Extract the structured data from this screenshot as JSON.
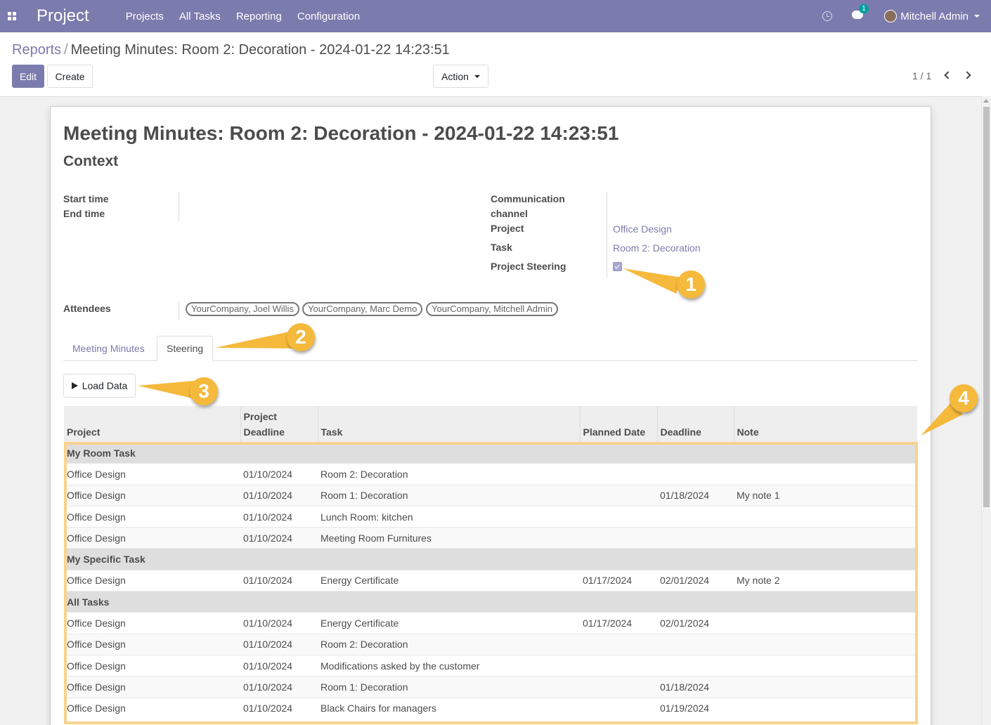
{
  "navbar": {
    "app_name": "Project",
    "menu": [
      "Projects",
      "All Tasks",
      "Reporting",
      "Configuration"
    ],
    "chat_badge": "1",
    "user": "Mitchell Admin",
    "bg_color": "#7c7bad"
  },
  "control_panel": {
    "breadcrumb_parent": "Reports",
    "breadcrumb_sep": "/",
    "breadcrumb_current": "Meeting Minutes: Room 2: Decoration - 2024-01-22 14:23:51",
    "edit_label": "Edit",
    "create_label": "Create",
    "action_label": "Action",
    "pager": "1 / 1"
  },
  "form": {
    "title": "Meeting Minutes: Room 2: Decoration - 2024-01-22 14:23:51",
    "subtitle": "Context",
    "start_time_label": "Start time",
    "end_time_label": "End time",
    "comm_channel_label_1": "Communication",
    "comm_channel_label_2": "channel",
    "project_label": "Project",
    "project_value": "Office Design",
    "task_label": "Task",
    "task_value": "Room 2: Decoration",
    "steering_label": "Project Steering",
    "steering_checked": true,
    "attendees_label": "Attendees",
    "attendees": [
      "YourCompany, Joel Willis",
      "YourCompany, Marc Demo",
      "YourCompany, Mitchell Admin"
    ]
  },
  "tabs": [
    "Meeting Minutes",
    "Steering"
  ],
  "load_button": "Load Data",
  "table": {
    "headers": {
      "project": "Project",
      "project_deadline_1": "Project",
      "project_deadline_2": "Deadline",
      "task": "Task",
      "planned_date": "Planned Date",
      "deadline": "Deadline",
      "note": "Note"
    },
    "rows": [
      {
        "group": "My Room Task"
      },
      {
        "project": "Office Design",
        "project_deadline": "01/10/2024",
        "task": "Room 2: Decoration",
        "planned": "",
        "deadline": "",
        "note": ""
      },
      {
        "project": "Office Design",
        "project_deadline": "01/10/2024",
        "task": "Room 1: Decoration",
        "planned": "",
        "deadline": "01/18/2024",
        "note": "My note 1"
      },
      {
        "project": "Office Design",
        "project_deadline": "01/10/2024",
        "task": "Lunch Room: kitchen",
        "planned": "",
        "deadline": "",
        "note": ""
      },
      {
        "project": "Office Design",
        "project_deadline": "01/10/2024",
        "task": "Meeting Room Furnitures",
        "planned": "",
        "deadline": "",
        "note": ""
      },
      {
        "group": "My Specific Task"
      },
      {
        "project": "Office Design",
        "project_deadline": "01/10/2024",
        "task": "Energy Certificate",
        "planned": "01/17/2024",
        "deadline": "02/01/2024",
        "note": "My note 2"
      },
      {
        "group": "All Tasks"
      },
      {
        "project": "Office Design",
        "project_deadline": "01/10/2024",
        "task": "Energy Certificate",
        "planned": "01/17/2024",
        "deadline": "02/01/2024",
        "note": ""
      },
      {
        "project": "Office Design",
        "project_deadline": "01/10/2024",
        "task": "Room 2: Decoration",
        "planned": "",
        "deadline": "",
        "note": ""
      },
      {
        "project": "Office Design",
        "project_deadline": "01/10/2024",
        "task": "Modifications asked by the customer",
        "planned": "",
        "deadline": "",
        "note": ""
      },
      {
        "project": "Office Design",
        "project_deadline": "01/10/2024",
        "task": "Room 1: Decoration",
        "planned": "",
        "deadline": "01/18/2024",
        "note": ""
      },
      {
        "project": "Office Design",
        "project_deadline": "01/10/2024",
        "task": "Black Chairs for managers",
        "planned": "",
        "deadline": "01/19/2024",
        "note": ""
      }
    ]
  },
  "callouts": [
    "1",
    "2",
    "3",
    "4"
  ],
  "colors": {
    "accent": "#7c7bad",
    "callout": "#f5b93b",
    "highlight": "#f8d38e"
  }
}
